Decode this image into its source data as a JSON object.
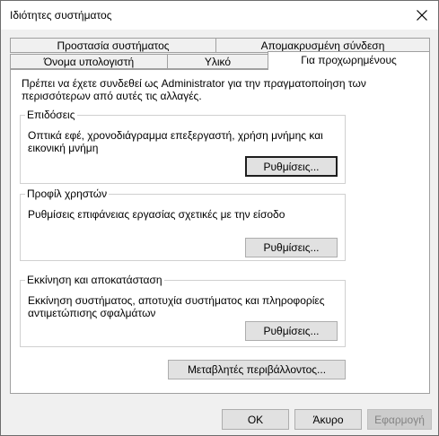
{
  "window": {
    "title": "Ιδιότητες συστήματος"
  },
  "tabs": {
    "row_back": [
      {
        "label": "Προστασία συστήματος"
      },
      {
        "label": "Απομακρυσμένη σύνδεση"
      }
    ],
    "row_front": [
      {
        "label": "Όνομα υπολογιστή"
      },
      {
        "label": "Υλικό"
      },
      {
        "label": "Για προχωρημένους"
      }
    ],
    "active": "Για προχωρημένους"
  },
  "panel": {
    "intro": "Πρέπει να έχετε συνδεθεί ως Administrator για την πραγματοποίηση των περισσότερων από αυτές τις αλλαγές.",
    "groups": [
      {
        "legend": "Επιδόσεις",
        "description": "Οπτικά εφέ, χρονοδιάγραμμα επεξεργαστή, χρήση μνήμης και εικονική μνήμη",
        "button": "Ρυθμίσεις..."
      },
      {
        "legend": "Προφίλ χρηστών",
        "description": "Ρυθμίσεις επιφάνειας εργασίας σχετικές με την είσοδο",
        "button": "Ρυθμίσεις..."
      },
      {
        "legend": "Εκκίνηση και αποκατάσταση",
        "description": "Εκκίνηση συστήματος, αποτυχία συστήματος και πληροφορίες αντιμετώπισης σφαλμάτων",
        "button": "Ρυθμίσεις..."
      }
    ],
    "env_button": "Μεταβλητές περιβάλλοντος..."
  },
  "footer": {
    "ok": "OK",
    "cancel": "Άκυρο",
    "apply": "Εφαρμογή"
  },
  "icons": {
    "close": "close-icon"
  }
}
